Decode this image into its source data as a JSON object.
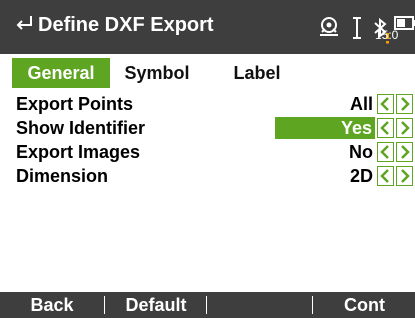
{
  "header": {
    "title": "Define DXF Export",
    "time": "15:0",
    "icons": [
      "back-arrow-icon",
      "target-lock-icon",
      "cursor-icon",
      "bluetooth-warning-icon",
      "battery-icon"
    ]
  },
  "tabs": [
    {
      "label": "General",
      "active": true
    },
    {
      "label": "Symbol",
      "active": false
    },
    {
      "label": "Label",
      "active": false
    }
  ],
  "rows": [
    {
      "label": "Export Points",
      "value": "All",
      "selected": false
    },
    {
      "label": "Show Identifier",
      "value": "Yes",
      "selected": true
    },
    {
      "label": "Export Images",
      "value": "No",
      "selected": false
    },
    {
      "label": "Dimension",
      "value": "2D",
      "selected": false
    }
  ],
  "softkeys": [
    "Back",
    "Default",
    "",
    "Cont"
  ],
  "colors": {
    "accent": "#5ea521",
    "bar": "#3e3e3e",
    "background": "#ffffff",
    "warning": "#f5a000"
  }
}
